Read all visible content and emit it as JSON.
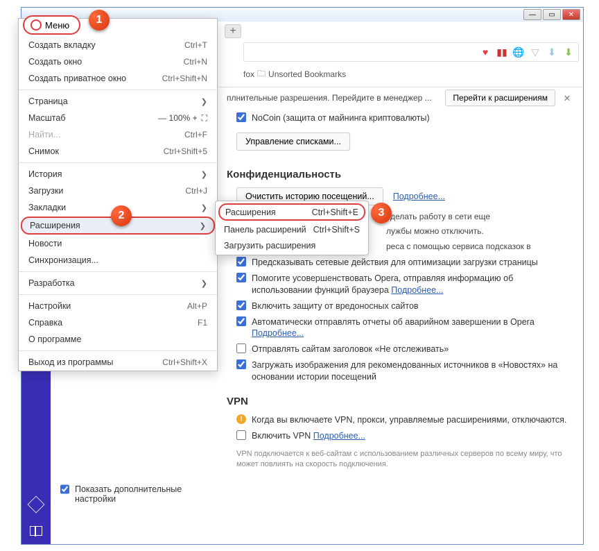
{
  "menu_button": "Меню",
  "menu": {
    "new_tab": {
      "label": "Создать вкладку",
      "shortcut": "Ctrl+T"
    },
    "new_window": {
      "label": "Создать окно",
      "shortcut": "Ctrl+N"
    },
    "new_private": {
      "label": "Создать приватное окно",
      "shortcut": "Ctrl+Shift+N"
    },
    "page": {
      "label": "Страница"
    },
    "zoom": {
      "label": "Масштаб",
      "value": "— 100% +",
      "full": "⛶"
    },
    "find": {
      "label": "Найти...",
      "shortcut": "Ctrl+F"
    },
    "snapshot": {
      "label": "Снимок",
      "shortcut": "Ctrl+Shift+5"
    },
    "history": {
      "label": "История"
    },
    "downloads": {
      "label": "Загрузки",
      "shortcut": "Ctrl+J"
    },
    "bookmarks": {
      "label": "Закладки"
    },
    "extensions": {
      "label": "Расширения"
    },
    "news": {
      "label": "Новости"
    },
    "sync": {
      "label": "Синхронизация..."
    },
    "dev": {
      "label": "Разработка"
    },
    "settings": {
      "label": "Настройки",
      "shortcut": "Alt+P"
    },
    "help": {
      "label": "Справка",
      "shortcut": "F1"
    },
    "about": {
      "label": "О программе"
    },
    "exit": {
      "label": "Выход из программы",
      "shortcut": "Ctrl+Shift+X"
    }
  },
  "submenu": {
    "extensions": {
      "label": "Расширения",
      "shortcut": "Ctrl+Shift+E"
    },
    "ext_panel": {
      "label": "Панель расширений",
      "shortcut": "Ctrl+Shift+S"
    },
    "load_ext": {
      "label": "Загрузить расширения"
    }
  },
  "bookmarks_bar": {
    "fox": "fox",
    "unsorted": "Unsorted Bookmarks"
  },
  "banner": {
    "text": "плнительные разрешения. Перейдите в менеджер ...",
    "button": "Перейти к расширениям"
  },
  "nocoin": "NoCoin (защита от майнинга криптовалюты)",
  "manage_lists": "Управление списками...",
  "privacy_header": "Конфиденциальность",
  "clear_history": "Очистить историю посещений...",
  "learn_more": "Подробнее...",
  "desc1": "сделать работу в сети еще",
  "desc2": "лужбы можно отключить.",
  "desc3": "реса с помощью сервиса подсказок в",
  "predict": "Предсказывать сетевые действия для оптимизации загрузки страницы",
  "improve": "Помогите усовершенствовать Opera, отправляя информацию об использовании функций браузера ",
  "malware": "Включить защиту от вредоносных сайтов",
  "crash": "Автоматически отправлять отчеты об аварийном завершении в Opera ",
  "dnt": "Отправлять сайтам заголовок «Не отслеживать»",
  "newsimg": "Загружать изображения для рекомендованных источников в «Новостях» на основании истории посещений",
  "vpn_header": "VPN",
  "vpn_warn": "Когда вы включаете VPN, прокси, управляемые расширениями, отключаются.",
  "vpn_enable": "Включить VPN ",
  "vpn_note": "VPN подключается к веб-сайтам с использованием различных серверов по всему миру, что может повлиять на скорость подключения.",
  "advanced": "Показать дополнительные настройки",
  "badges": {
    "b1": "1",
    "b2": "2",
    "b3": "3"
  }
}
